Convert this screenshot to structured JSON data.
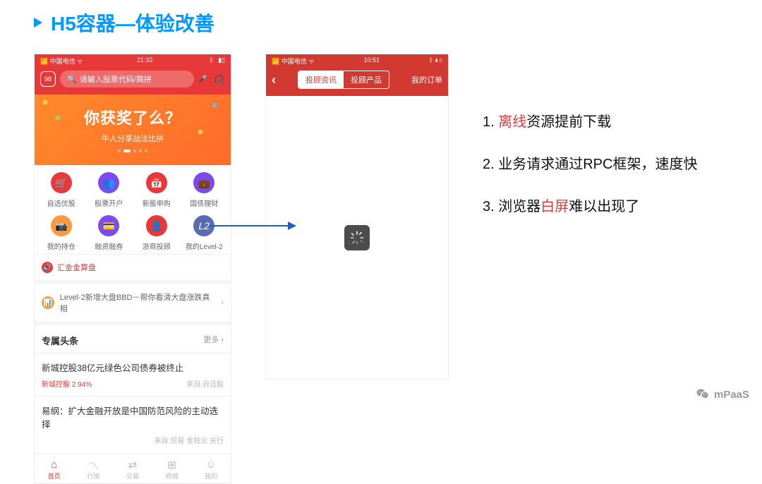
{
  "slide": {
    "title": "H5容器—体验改善"
  },
  "phone1": {
    "status": {
      "left": "📶 中国电信 ᯤ",
      "time": "21:32"
    },
    "search": {
      "badge": "98",
      "placeholder": "请输入股票代码/简拼"
    },
    "banner": {
      "title": "你获奖了么？",
      "subtitle": "牛人分享战法比拼"
    },
    "grid": [
      "自选优股",
      "股票开户",
      "新股申购",
      "国债理财",
      "我的持仓",
      "融资融券",
      "浙商投顾",
      "我的Level-2"
    ],
    "announcement": "汇金金算盘",
    "info_row": "Level-2新增大盘BBD－帮你看清大盘涨跌真相",
    "headlines": {
      "title": "专属头条",
      "more": "更多 ›"
    },
    "news": [
      {
        "title": "新城控股38亿元绿色公司债券被终止",
        "tag": "新城控股  2.94%",
        "src": "来自:自选股"
      },
      {
        "title": "易纲：扩大金融开放是中国防范风险的主动选择",
        "src": "来自:贸易 金融业 央行"
      }
    ],
    "tabs": [
      "首页",
      "行情",
      "交易",
      "商城",
      "我的"
    ]
  },
  "phone2": {
    "status": {
      "left": "📶 中国电信 ᯤ",
      "time": "10:51"
    },
    "segments": [
      "投顾资讯",
      "投顾产品"
    ],
    "orders": "我的订单"
  },
  "bullets": [
    {
      "pre": "1. ",
      "hl": "离线",
      "post": "资源提前下载"
    },
    {
      "text": "2. 业务请求通过RPC框架，速度快"
    },
    {
      "pre": "3. 浏览器",
      "hl": "白屏",
      "post": "难以出现了"
    }
  ],
  "watermark": "mPaaS"
}
